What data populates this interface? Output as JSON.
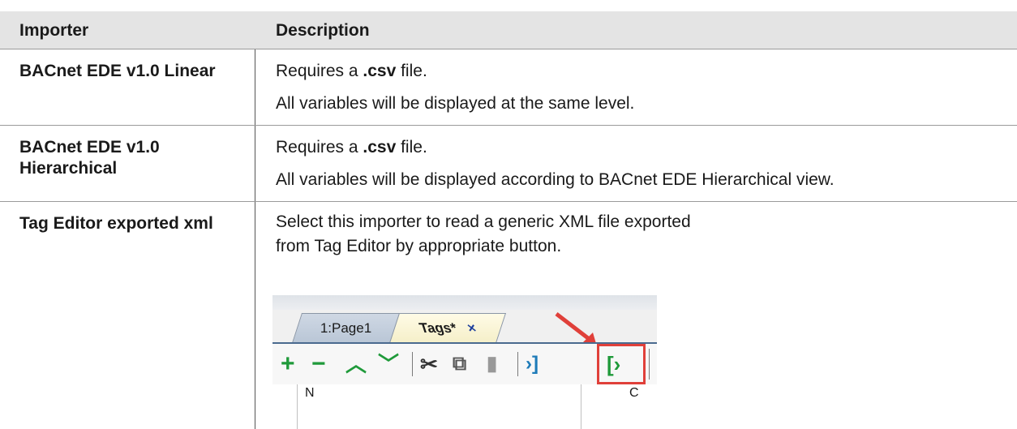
{
  "header": {
    "col1": "Importer",
    "col2": "Description"
  },
  "rows": [
    {
      "name": "BACnet EDE v1.0 Linear",
      "desc_lines": [
        {
          "prefix": "Requires a ",
          "bold": ".csv",
          "suffix": " file."
        },
        {
          "text": "All variables will be displayed at the same level."
        }
      ]
    },
    {
      "name": "BACnet EDE v1.0 Hierarchical",
      "desc_lines": [
        {
          "prefix": "Requires a ",
          "bold": ".csv",
          "suffix": " file."
        },
        {
          "text": "All variables will be displayed according to BACnet EDE Hierarchical view."
        }
      ]
    },
    {
      "name": "Tag Editor exported xml",
      "desc_lines": [
        {
          "text": "Select this importer to read a generic XML file exported from Tag Editor by appropriate button."
        }
      ]
    }
  ],
  "screenshot": {
    "tabs": [
      "1:Page1",
      "Tags*"
    ],
    "tab_close": "×",
    "toolbar_icons": [
      "plus-icon",
      "minus-icon",
      "chevron-up-icon",
      "chevron-down-icon",
      "cut-icon",
      "copy-icon",
      "paste-icon",
      "export-icon",
      "import-icon"
    ],
    "grid_headers": [
      "N",
      "C"
    ],
    "highlight_color": "#e0403a",
    "toolbar_color": "#1f9a3a"
  }
}
